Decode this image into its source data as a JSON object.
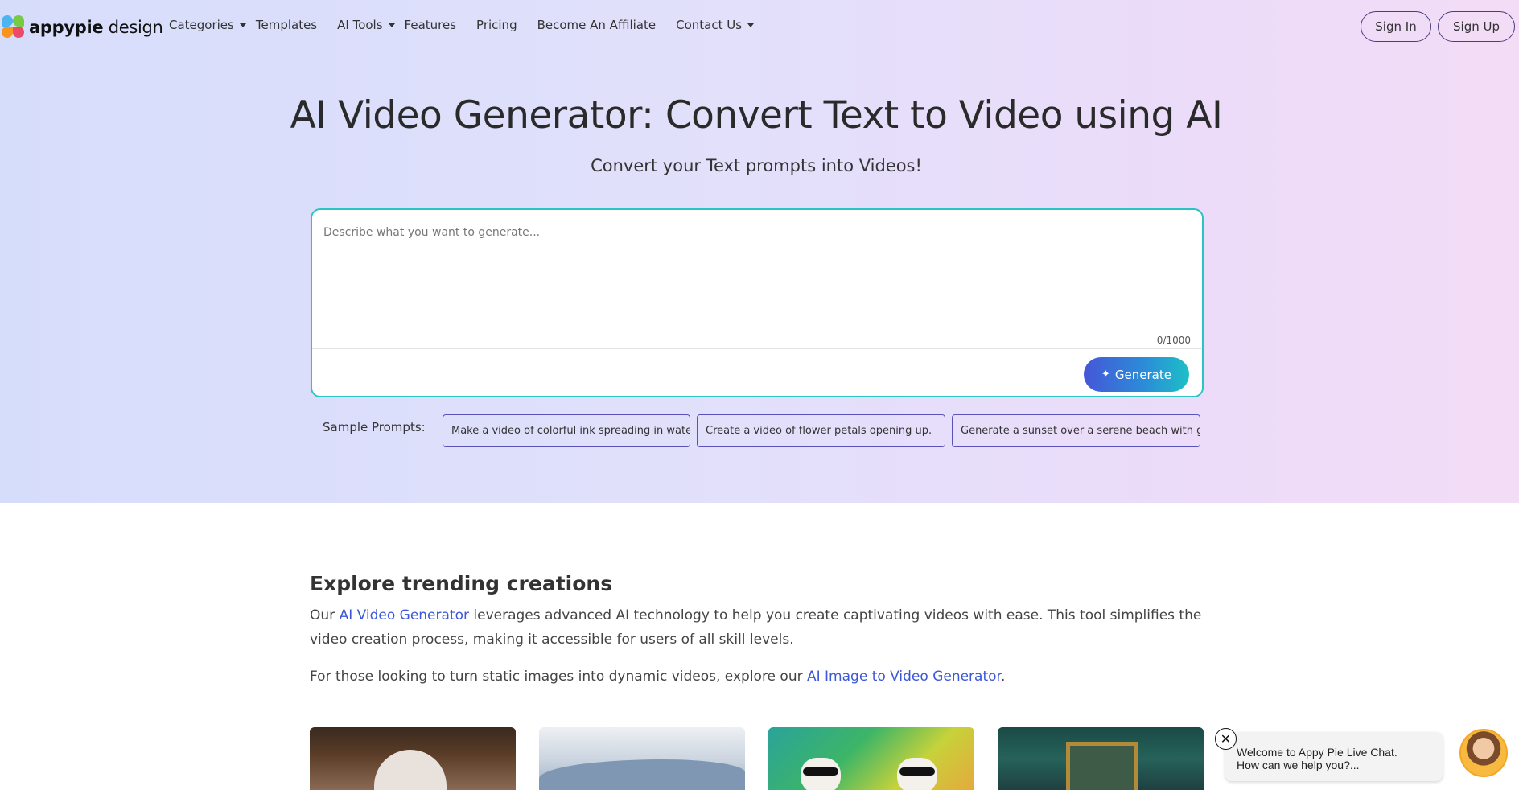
{
  "header": {
    "logo_bold": "appypie",
    "logo_light": " design",
    "nav": [
      {
        "label": "Categories",
        "dropdown": true
      },
      {
        "label": "Templates",
        "dropdown": false
      },
      {
        "label": "AI Tools",
        "dropdown": true
      },
      {
        "label": "Features",
        "dropdown": false
      },
      {
        "label": "Pricing",
        "dropdown": false
      },
      {
        "label": "Become An Affiliate",
        "dropdown": false
      },
      {
        "label": "Contact Us",
        "dropdown": true
      }
    ],
    "sign_in": "Sign In",
    "sign_up": "Sign Up"
  },
  "hero": {
    "title": "AI Video Generator: Convert Text to Video using AI",
    "subtitle": "Convert your Text prompts into Videos!",
    "prompt_placeholder": "Describe what you want to generate...",
    "prompt_value": "",
    "counter": "0/1000",
    "generate_label": "Generate",
    "samples_label": "Sample Prompts:",
    "samples": [
      "Make a video of colorful ink spreading in water.",
      "Create a video of flower petals opening up.",
      "Generate a sunset over a serene beach with g..."
    ]
  },
  "explore": {
    "title": "Explore trending creations",
    "p1_before": "Our ",
    "p1_link": "AI Video Generator",
    "p1_after": " leverages advanced AI technology to help you create captivating videos with ease. This tool simplifies the video creation process, making it accessible for users of all skill levels.",
    "p2_before": "For those looking to turn static images into dynamic videos, explore our ",
    "p2_link": "AI Image to Video Generator",
    "p2_after": "."
  },
  "chat": {
    "line1": "Welcome to Appy Pie Live Chat.",
    "line2": "How can we help you?..."
  },
  "colors": {
    "accent": "#2ac4c4",
    "link": "#3c58d8",
    "chip_border": "#5a52b8"
  }
}
